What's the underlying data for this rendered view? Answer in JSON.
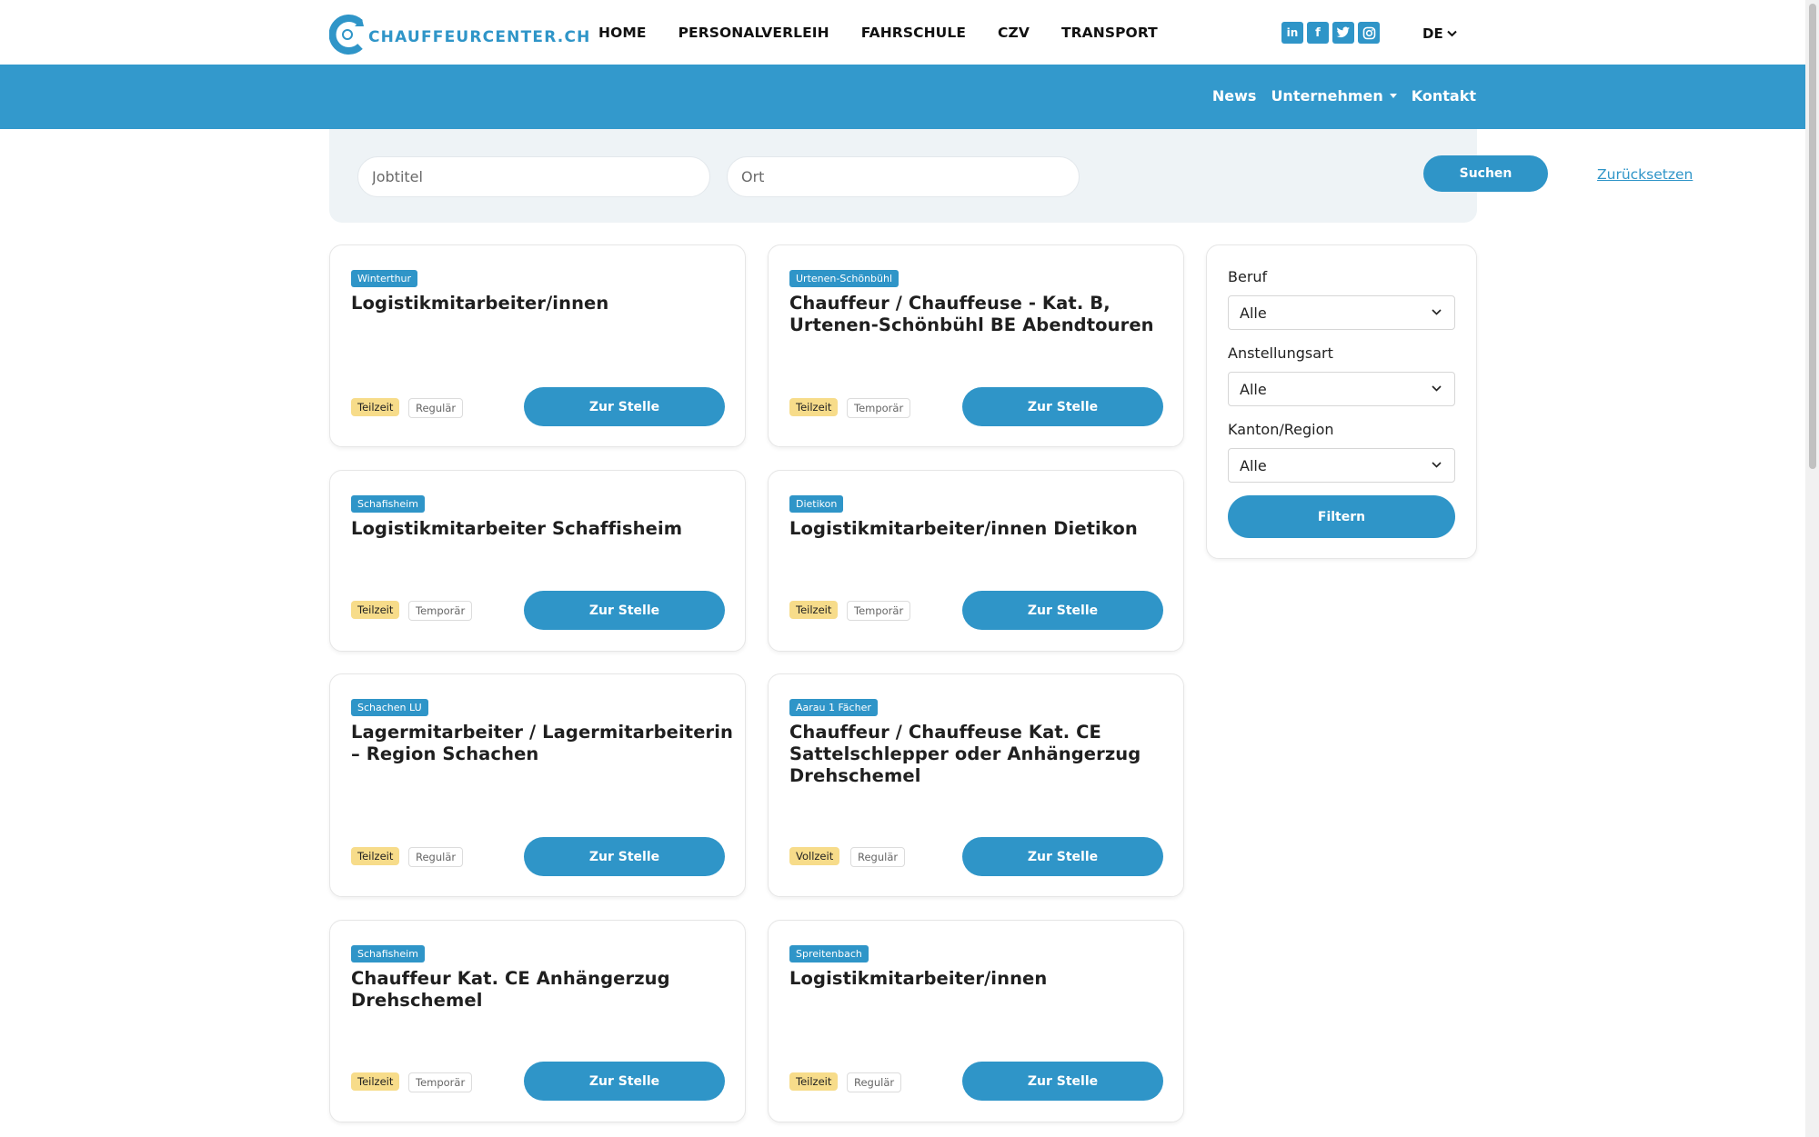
{
  "brand": {
    "name": "CHAUFFEURCENTER.CH",
    "color": "#2f95c8"
  },
  "nav": {
    "items": [
      "HOME",
      "PERSONALVERLEIH",
      "FAHRSCHULE",
      "CZV",
      "TRANSPORT"
    ],
    "language": "DE",
    "socials": [
      "linkedin-icon",
      "facebook-icon",
      "twitter-icon",
      "instagram-icon"
    ]
  },
  "subnav": {
    "news": "News",
    "company": "Unternehmen",
    "contact": "Kontakt"
  },
  "search": {
    "title_placeholder": "Jobtitel",
    "location_placeholder": "Ort",
    "submit": "Suchen",
    "reset": "Zurücksetzen"
  },
  "jobs": [
    {
      "location": "Winterthur",
      "title": "Logistikmitarbeiter/innen",
      "workload": "Teilzeit",
      "type": "Regulär",
      "action": "Zur Stelle"
    },
    {
      "location": "Urtenen-Schönbühl",
      "title": "Chauffeur / Chauffeuse - Kat. B, Urtenen-Schönbühl BE Abendtouren",
      "workload": "Teilzeit",
      "type": "Temporär",
      "action": "Zur Stelle"
    },
    {
      "location": "Schafisheim",
      "title": "Logistikmitarbeiter Schaffisheim",
      "workload": "Teilzeit",
      "type": "Temporär",
      "action": "Zur Stelle"
    },
    {
      "location": "Dietikon",
      "title": "Logistikmitarbeiter/innen Dietikon",
      "workload": "Teilzeit",
      "type": "Temporär",
      "action": "Zur Stelle"
    },
    {
      "location": "Schachen LU",
      "title": "Lagermitarbeiter / Lagermitarbeiterin – Region Schachen",
      "workload": "Teilzeit",
      "type": "Regulär",
      "action": "Zur Stelle"
    },
    {
      "location": "Aarau 1 Fächer",
      "title": "Chauffeur / Chauffeuse Kat. CE Sattelschlepper oder Anhängerzug Drehschemel",
      "workload": "Vollzeit",
      "type": "Regulär",
      "action": "Zur Stelle"
    },
    {
      "location": "Schafisheim",
      "title": "Chauffeur Kat. CE Anhängerzug Drehschemel",
      "workload": "Teilzeit",
      "type": "Temporär",
      "action": "Zur Stelle"
    },
    {
      "location": "Spreitenbach",
      "title": "Logistikmitarbeiter/innen",
      "workload": "Teilzeit",
      "type": "Regulär",
      "action": "Zur Stelle"
    }
  ],
  "filters": {
    "profession_label": "Beruf",
    "profession_value": "Alle",
    "employment_label": "Anstellungsart",
    "employment_value": "Alle",
    "region_label": "Kanton/Region",
    "region_value": "Alle",
    "submit": "Filtern"
  }
}
